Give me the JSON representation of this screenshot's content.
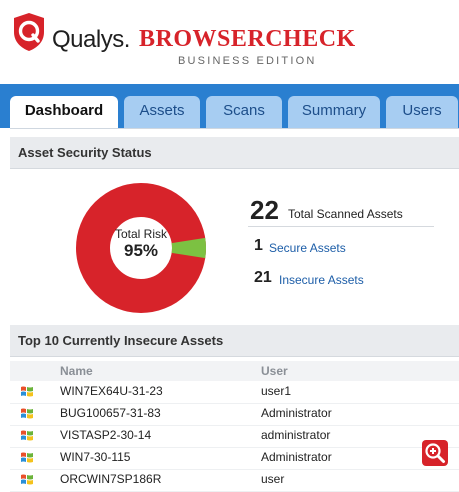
{
  "brand": {
    "qualys": "Qualys.",
    "product": "BROWSERCHECK",
    "edition": "BUSINESS EDITION",
    "logo_color": "#d7232a"
  },
  "tabs": [
    {
      "label": "Dashboard",
      "active": true
    },
    {
      "label": "Assets",
      "active": false
    },
    {
      "label": "Scans",
      "active": false
    },
    {
      "label": "Summary",
      "active": false
    },
    {
      "label": "Users",
      "active": false
    }
  ],
  "status": {
    "heading": "Asset Security Status",
    "risk_label": "Total Risk",
    "risk_value": "95%",
    "risk_fraction": 0.95,
    "risk_color": "#d7232a",
    "safe_color": "#7cc142",
    "total_count": "22",
    "total_label": "Total Scanned Assets",
    "secure_count": "1",
    "secure_label": "Secure Assets",
    "insecure_count": "21",
    "insecure_label": "Insecure Assets"
  },
  "insecure": {
    "heading": "Top 10 Currently Insecure Assets",
    "columns": [
      "Name",
      "User"
    ],
    "rows": [
      {
        "name": "WIN7EX64U-31-23",
        "user": "user1",
        "icon": "windows-icon"
      },
      {
        "name": "BUG100657-31-83",
        "user": "Administrator",
        "icon": "windows-icon"
      },
      {
        "name": "VISTASP2-30-14",
        "user": "administrator",
        "icon": "windows-icon"
      },
      {
        "name": "WIN7-30-115",
        "user": "Administrator",
        "icon": "windows-icon"
      },
      {
        "name": "ORCWIN7SP186R",
        "user": "user",
        "icon": "windows-icon"
      }
    ]
  },
  "zoom": {
    "icon": "zoom-in-icon"
  }
}
